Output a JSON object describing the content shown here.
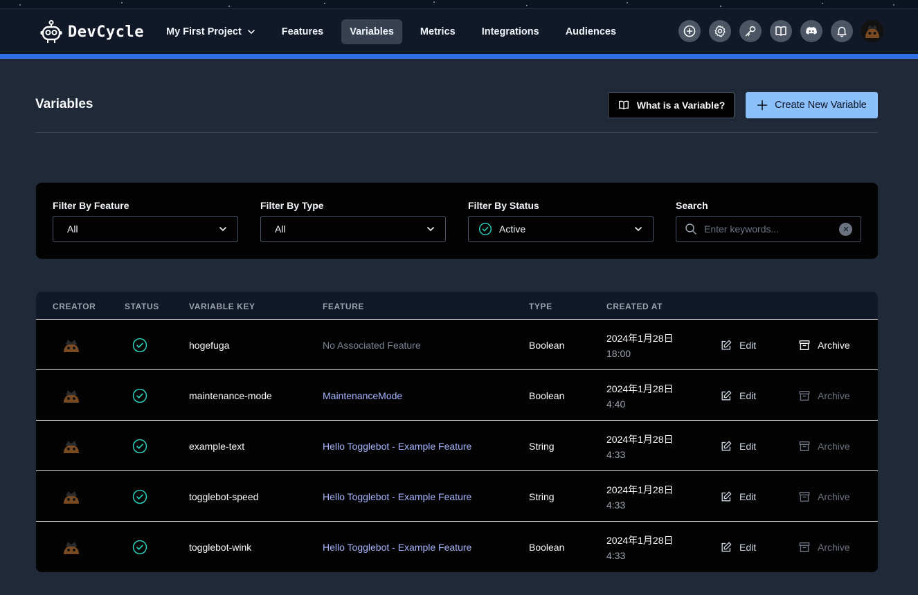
{
  "app": {
    "name": "DevCycle"
  },
  "nav": {
    "project": "My First Project",
    "items": [
      {
        "label": "Features",
        "active": false
      },
      {
        "label": "Variables",
        "active": true
      },
      {
        "label": "Metrics",
        "active": false
      },
      {
        "label": "Integrations",
        "active": false
      },
      {
        "label": "Audiences",
        "active": false
      }
    ],
    "icons": [
      "add-circle-icon",
      "gear-icon",
      "key-icon",
      "book-icon",
      "discord-icon",
      "bell-icon",
      "avatar"
    ]
  },
  "page": {
    "title": "Variables",
    "what_button": "What is a Variable?",
    "create_button": "Create New Variable"
  },
  "filters": {
    "feature": {
      "label": "Filter By Feature",
      "value": "All"
    },
    "type": {
      "label": "Filter By Type",
      "value": "All"
    },
    "status": {
      "label": "Filter By Status",
      "value": "Active"
    },
    "search": {
      "label": "Search",
      "placeholder": "Enter keywords..."
    }
  },
  "table": {
    "headers": {
      "creator": "CREATOR",
      "status": "STATUS",
      "key": "VARIABLE KEY",
      "feature": "FEATURE",
      "type": "TYPE",
      "created": "CREATED AT"
    },
    "edit_label": "Edit",
    "archive_label": "Archive",
    "rows": [
      {
        "key": "hogefuga",
        "feature": "No Associated Feature",
        "feature_linked": false,
        "type": "Boolean",
        "date": "2024年1月28日",
        "time": "18:00",
        "archive_enabled": true
      },
      {
        "key": "maintenance-mode",
        "feature": "MaintenanceMode",
        "feature_linked": true,
        "type": "Boolean",
        "date": "2024年1月28日",
        "time": "4:40",
        "archive_enabled": false
      },
      {
        "key": "example-text",
        "feature": "Hello Togglebot - Example Feature",
        "feature_linked": true,
        "type": "String",
        "date": "2024年1月28日",
        "time": "4:33",
        "archive_enabled": false
      },
      {
        "key": "togglebot-speed",
        "feature": "Hello Togglebot - Example Feature",
        "feature_linked": true,
        "type": "String",
        "date": "2024年1月28日",
        "time": "4:33",
        "archive_enabled": false
      },
      {
        "key": "togglebot-wink",
        "feature": "Hello Togglebot - Example Feature",
        "feature_linked": true,
        "type": "Boolean",
        "date": "2024年1月28日",
        "time": "4:33",
        "archive_enabled": false
      }
    ]
  },
  "colors": {
    "accent_bar": "#2f6fe4",
    "primary_button": "#8cc0fb",
    "status_active": "#2dd4bf",
    "feature_link": "#a5b4fc"
  }
}
